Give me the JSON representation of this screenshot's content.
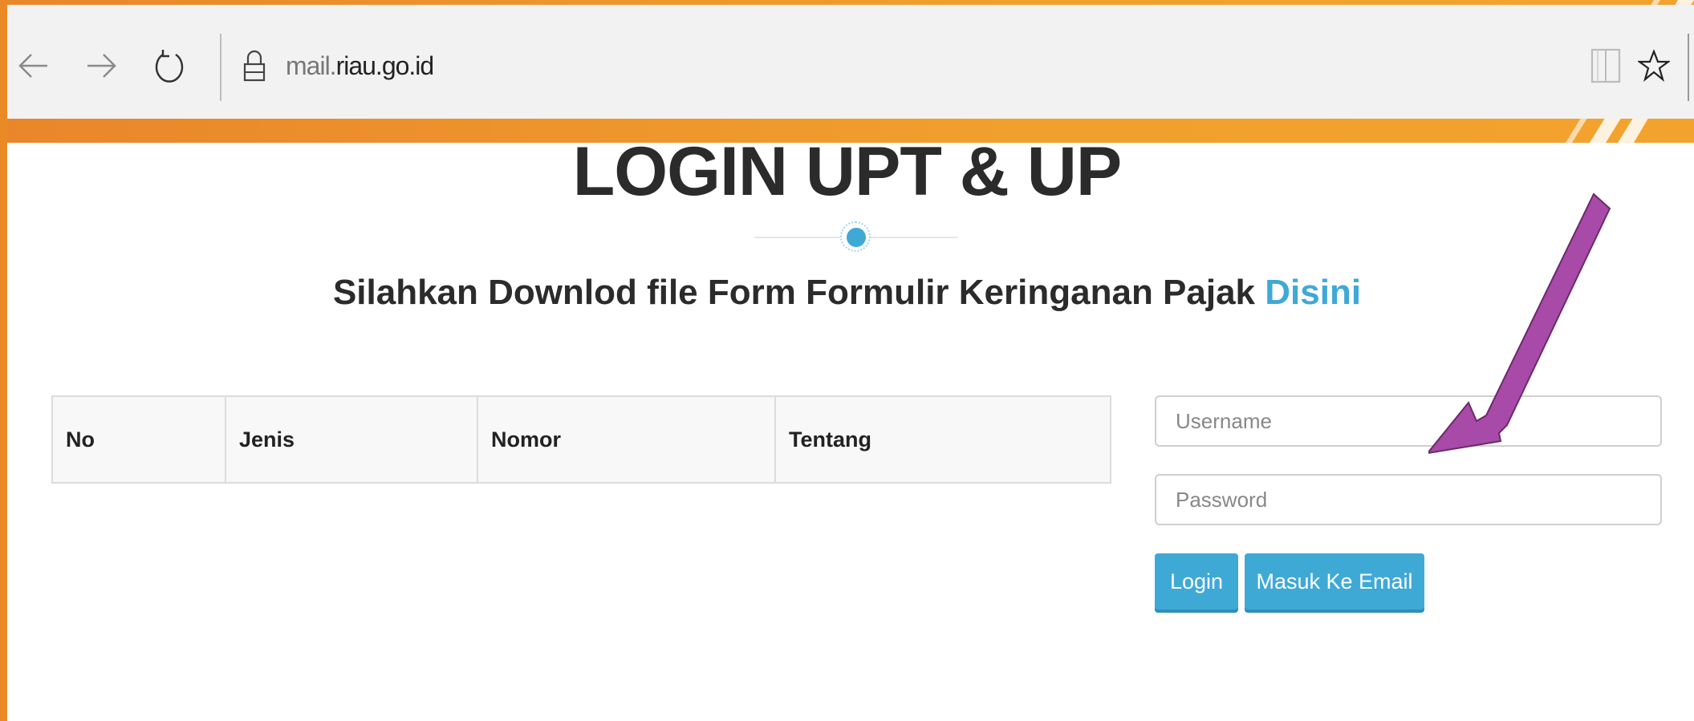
{
  "browser": {
    "url_prefix": "mail.",
    "url_domain": "riau.go.id",
    "icons": [
      "back-arrow-icon",
      "forward-arrow-icon",
      "refresh-icon",
      "lock-icon",
      "reading-view-icon",
      "favorite-star-icon"
    ]
  },
  "page": {
    "title": "LOGIN UPT & UP",
    "subtitle_text": "Silahkan Downlod file Form Formulir Keringanan Pajak",
    "subtitle_link": "Disini"
  },
  "table": {
    "headers": [
      "No",
      "Jenis",
      "Nomor",
      "Tentang"
    ]
  },
  "login": {
    "username_placeholder": "Username",
    "password_placeholder": "Password",
    "login_label": "Login",
    "email_label": "Masuk Ke Email"
  },
  "colors": {
    "frame_orange": "#e9862a",
    "accent_blue": "#3fa9d6",
    "arrow_purple": "#a84aa8"
  }
}
